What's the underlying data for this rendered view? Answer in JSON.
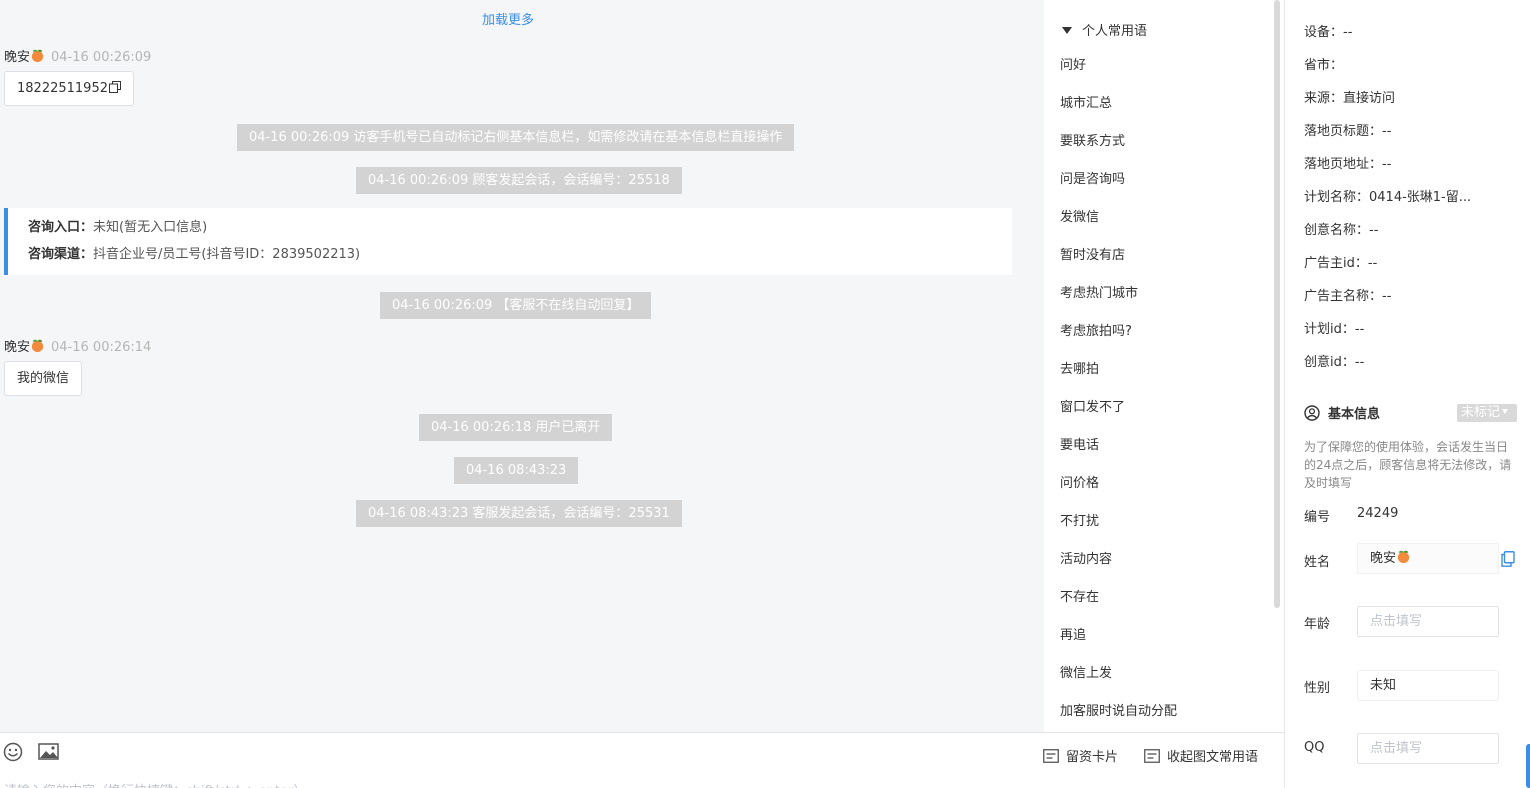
{
  "chat": {
    "load_more": "加载更多",
    "messages": [
      {
        "sender": "晚安",
        "time": "04-16 00:26:09",
        "content": "18222511952"
      },
      {
        "sender": "晚安",
        "time": "04-16 00:26:14",
        "content": "我的微信"
      }
    ],
    "system_notices": [
      "04-16 00:26:09 访客手机号已自动标记右侧基本信息栏，如需修改请在基本信息栏直接操作",
      "04-16 00:26:09 顾客发起会话，会话编号：25518",
      "04-16 00:26:09 【客服不在线自动回复】",
      "04-16 00:26:18 用户已离开",
      "04-16 08:43:23",
      "04-16 08:43:23 客服发起会话，会话编号：25531"
    ],
    "info_card": {
      "entry_label": "咨询入口：",
      "entry_value": "未知(暂无入口信息)",
      "channel_label": "咨询渠道：",
      "channel_value": "抖音企业号/员工号(抖音号ID：2839502213)"
    }
  },
  "quick_replies": {
    "group_title": "个人常用语",
    "items": [
      "问好",
      "城市汇总",
      "要联系方式",
      "问是咨询吗",
      "发微信",
      "暂时没有店",
      "考虑热门城市",
      "考虑旅拍吗?",
      "去哪拍",
      "窗口发不了",
      "要电话",
      "问价格",
      "不打扰",
      "活动内容",
      "不存在",
      "再追",
      "微信上发",
      "加客服时说自动分配"
    ]
  },
  "composer": {
    "placeholder": "请输入您的内容（换行快捷键：shift/ctrl + enter）",
    "card_button": "留资卡片",
    "collapse_button": "收起图文常用语"
  },
  "panel": {
    "fields": [
      {
        "label": "设备：",
        "value": "--"
      },
      {
        "label": "省市：",
        "value": ""
      },
      {
        "label": "来源：",
        "value": "直接访问"
      },
      {
        "label": "落地页标题：",
        "value": "--"
      },
      {
        "label": "落地页地址：",
        "value": "--"
      },
      {
        "label": "计划名称：",
        "value": "0414-张琳1-留..."
      },
      {
        "label": "创意名称：",
        "value": "--"
      },
      {
        "label": "广告主id：",
        "value": "--"
      },
      {
        "label": "广告主名称：",
        "value": "--"
      },
      {
        "label": "计划id：",
        "value": "--"
      },
      {
        "label": "创意id：",
        "value": "--"
      }
    ],
    "basic_info_title": "基本信息",
    "tag_select": "未标记",
    "notice": "为了保障您的使用体验，会话发生当日的24点之后，顾客信息将无法修改，请及时填写",
    "id_label": "编号",
    "id_value": "24249",
    "name_label": "姓名",
    "name_value": "晚安",
    "age_label": "年龄",
    "age_placeholder": "点击填写",
    "gender_label": "性别",
    "gender_value": "未知",
    "qq_label": "QQ",
    "qq_placeholder": "点击填写"
  },
  "colors": {
    "accent": "#3a8ee6",
    "system_bg": "#d3d3d3",
    "chat_bg": "#f5f6f8"
  }
}
